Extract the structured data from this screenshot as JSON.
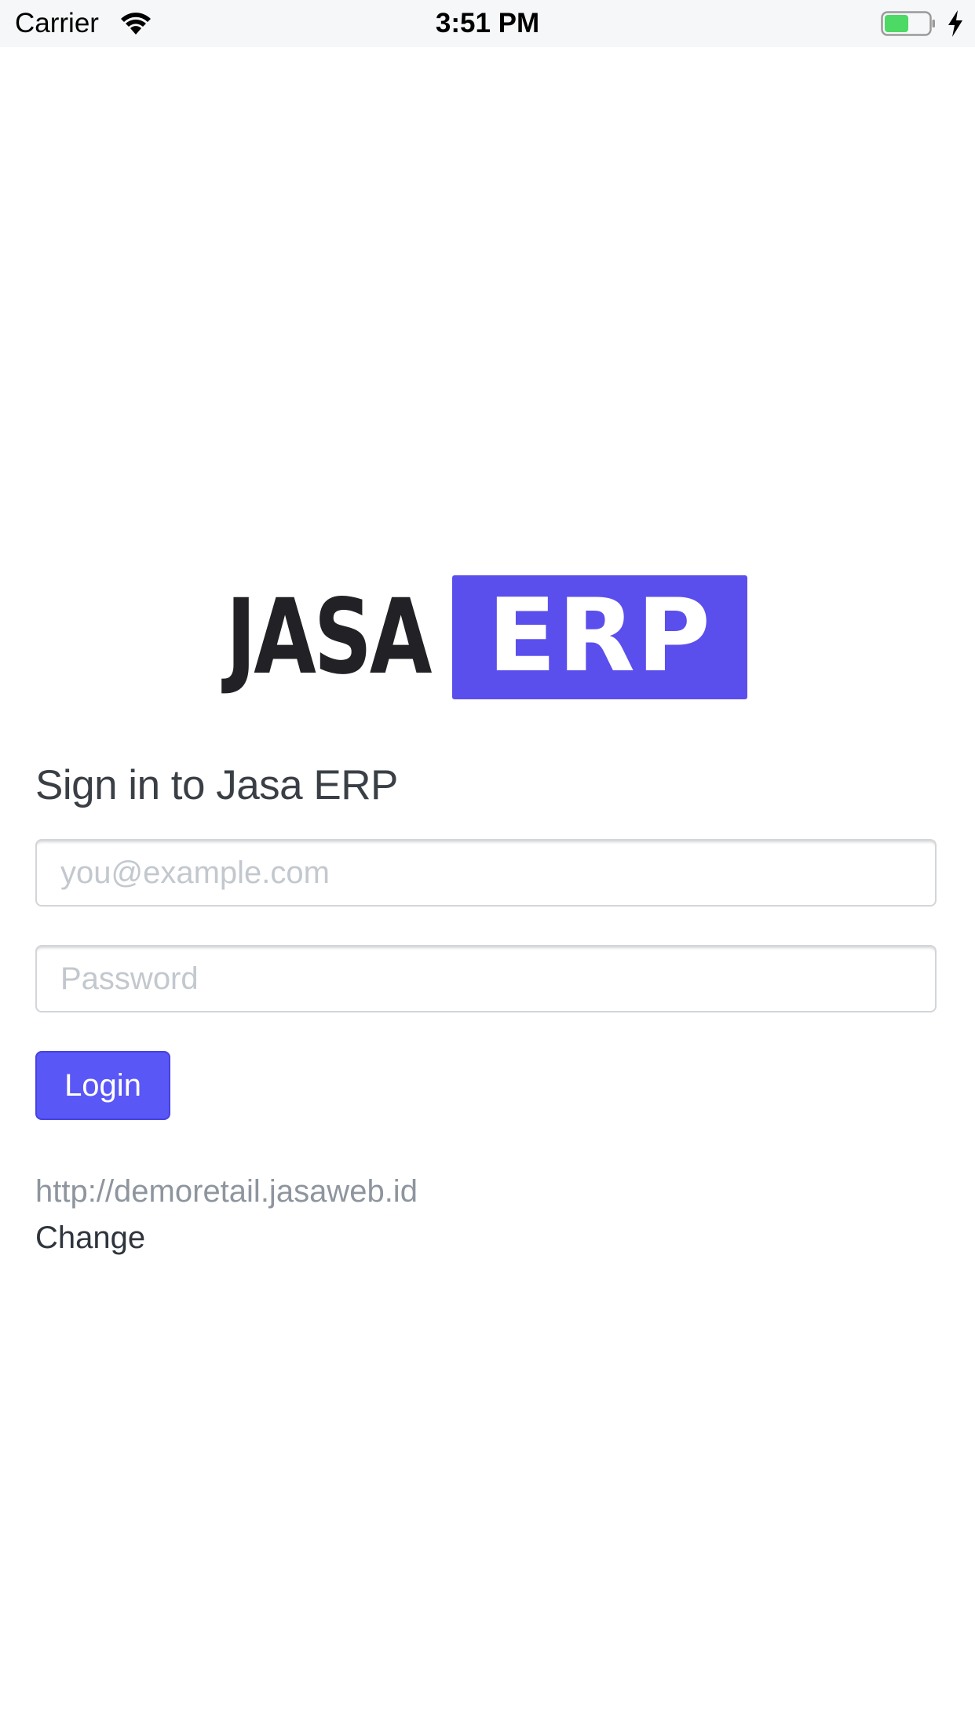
{
  "status_bar": {
    "carrier": "Carrier",
    "time": "3:51 PM",
    "icons": [
      "wifi-icon",
      "battery-icon",
      "charging-bolt-icon"
    ],
    "battery_color": "#4cd964"
  },
  "logo": {
    "word_left": "JASA",
    "word_right": "ERP",
    "brand_color": "#5a4fec",
    "dark_color": "#222226"
  },
  "login": {
    "title": "Sign in to Jasa ERP",
    "email_placeholder": "you@example.com",
    "password_placeholder": "Password",
    "button_label": "Login",
    "accent_color": "#5a57f7"
  },
  "server": {
    "url": "http://demoretail.jasaweb.id",
    "change_label": "Change"
  }
}
